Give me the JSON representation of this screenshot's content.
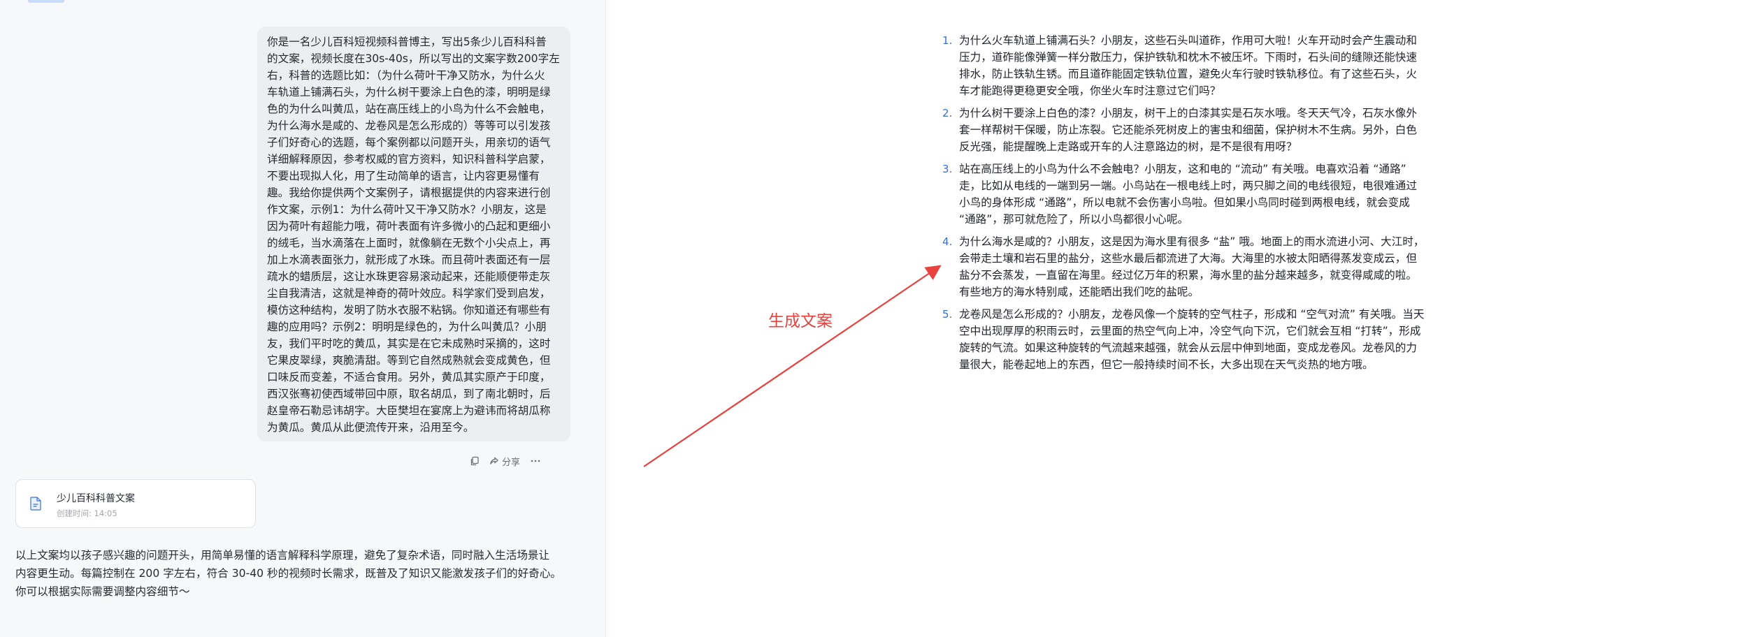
{
  "prompt": {
    "text": "你是一名少儿百科短视频科普博主，写出5条少儿百科科普\n的文案，视频长度在30s-40s，所以写出的文案字数200字左\n右，科普的选题比如：（为什么荷叶干净又防水，为什么火\n车轨道上铺满石头，为什么树干要涂上白色的漆，明明是绿\n色的为什么叫黄瓜，站在高压线上的小鸟为什么不会触电，\n为什么海水是咸的、龙卷风是怎么形成的）等等可以引发孩\n子们好奇心的选题，每个案例都以问题开头，用亲切的语气\n详细解释原因，参考权威的官方资料，知识科普科学启蒙，\n不要出现拟人化，用了生动简单的语言，让内容更易懂有\n趣。我给你提供两个文案例子，请根据提供的内容来进行创\n作文案，示例1：为什么荷叶又干净又防水？小朋友，这是\n因为荷叶有超能力哦，荷叶表面有许多微小的凸起和更细小\n的绒毛，当水滴落在上面时，就像躺在无数个小尖点上，再\n加上水滴表面张力，就形成了水珠。而且荷叶表面还有一层\n疏水的蜡质层，这让水珠更容易滚动起来，还能顺便带走灰\n尘自我清洁，这就是神奇的荷叶效应。科学家们受到启发，\n模仿这种结构，发明了防水衣服不粘锅。你知道还有哪些有\n趣的应用吗？示例2：明明是绿色的，为什么叫黄瓜？小朋\n友，我们平时吃的黄瓜，其实是在它未成熟时采摘的，这时\n它果皮翠绿，爽脆清甜。等到它自然成熟就会变成黄色，但\n口味反而变差，不适合食用。另外，黄瓜其实原产于印度，\n西汉张骞初使西域带回中原，取名胡瓜，到了南北朝时，后\n赵皇帝石勒忌讳胡字。大臣樊坦在宴席上为避讳而将胡瓜称\n为黄瓜。黄瓜从此便流传开来，沿用至今。"
  },
  "actions": {
    "share_label": "分享",
    "copy_icon": "copy-icon",
    "share_icon": "share-icon",
    "more_icon": "more-icon"
  },
  "file_card": {
    "title": "少儿百科科普文案",
    "created_label": "创建时间:",
    "created_time": "14:05",
    "icon": "document-icon"
  },
  "summary": "以上文案均以孩子感兴趣的问题开头，用简单易懂的语言解释科学原理，避免了复杂术语，同时融入生活场景让\n内容更生动。每篇控制在 200 字左右，符合 30-40 秒的视频时长需求，既普及了知识又能激发孩子们的好奇心。\n你可以根据实际需要调整内容细节～",
  "annotation": {
    "label": "生成文案",
    "color": "#e8413e"
  },
  "document": {
    "items": [
      {
        "num": "1.",
        "text": "为什么火车轨道上铺满石头？小朋友，这些石头叫道砟，作用可大啦！火车开动时会产生震动和\n压力，道砟能像弹簧一样分散压力，保护铁轨和枕木不被压坏。下雨时，石头间的缝隙还能快速\n排水，防止铁轨生锈。而且道砟能固定铁轨位置，避免火车行驶时铁轨移位。有了这些石头，火\n车才能跑得更稳更安全哦，你坐火车时注意过它们吗？"
      },
      {
        "num": "2.",
        "text": "为什么树干要涂上白色的漆？小朋友，树干上的白漆其实是石灰水哦。冬天天气冷，石灰水像外\n套一样帮树干保暖，防止冻裂。它还能杀死树皮上的害虫和细菌，保护树木不生病。另外，白色\n反光强，能提醒晚上走路或开车的人注意路边的树，是不是很有用呀？"
      },
      {
        "num": "3.",
        "text": "站在高压线上的小鸟为什么不会触电？小朋友，这和电的 “流动” 有关哦。电喜欢沿着 “通路”\n走，比如从电线的一端到另一端。小鸟站在一根电线上时，两只脚之间的电线很短，电很难通过\n小鸟的身体形成 “通路”，所以电就不会伤害小鸟啦。但如果小鸟同时碰到两根电线，就会变成\n“通路”，那可就危险了，所以小鸟都很小心呢。"
      },
      {
        "num": "4.",
        "text": "为什么海水是咸的？小朋友，这是因为海水里有很多 “盐” 哦。地面上的雨水流进小河、大江时，\n会带走土壤和岩石里的盐分，这些水最后都流进了大海。大海里的水被太阳晒得蒸发变成云，但\n盐分不会蒸发，一直留在海里。经过亿万年的积累，海水里的盐分越来越多，就变得咸咸的啦。\n有些地方的海水特别咸，还能晒出我们吃的盐呢。"
      },
      {
        "num": "5.",
        "text": "龙卷风是怎么形成的？小朋友，龙卷风像一个旋转的空气柱子，形成和 “空气对流” 有关哦。当天\n空中出现厚厚的积雨云时，云里面的热空气向上冲，冷空气向下沉，它们就会互相 “打转”，形成\n旋转的气流。如果这种旋转的气流越来越强，就会从云层中伸到地面，变成龙卷风。龙卷风的力\n量很大，能卷起地上的东西，但它一般持续时间不长，大多出现在天气炎热的地方哦。"
      }
    ]
  }
}
